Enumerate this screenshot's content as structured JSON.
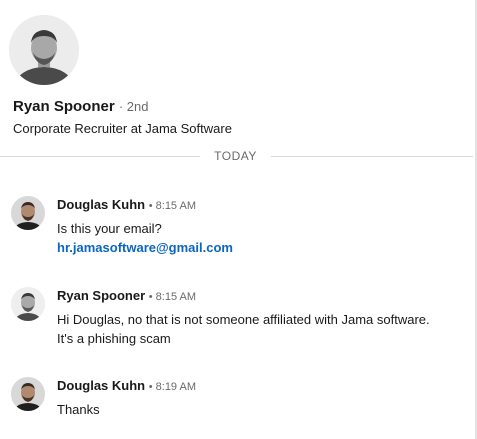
{
  "profile": {
    "name": "Ryan Spooner",
    "degree": "· 2nd",
    "headline": "Corporate Recruiter at Jama Software",
    "avatar_icon": "profile-photo-avatar"
  },
  "divider": {
    "label": "TODAY"
  },
  "messages": [
    {
      "sender": "Douglas Kuhn",
      "time": "• 8:15 AM",
      "lines": [
        "Is this your email?"
      ],
      "link": "hr.jamasoftware@gmail.com"
    },
    {
      "sender": "Ryan Spooner",
      "time": "• 8:15 AM",
      "lines": [
        "Hi Douglas, no that is not someone affiliated with Jama software.",
        "It's a phishing scam"
      ]
    },
    {
      "sender": "Douglas Kuhn",
      "time": "• 8:19 AM",
      "lines": [
        "Thanks"
      ]
    }
  ],
  "colors": {
    "link": "#0a66c2",
    "secondary_text": "rgba(0,0,0,0.6)",
    "divider": "#d7d7d7"
  }
}
